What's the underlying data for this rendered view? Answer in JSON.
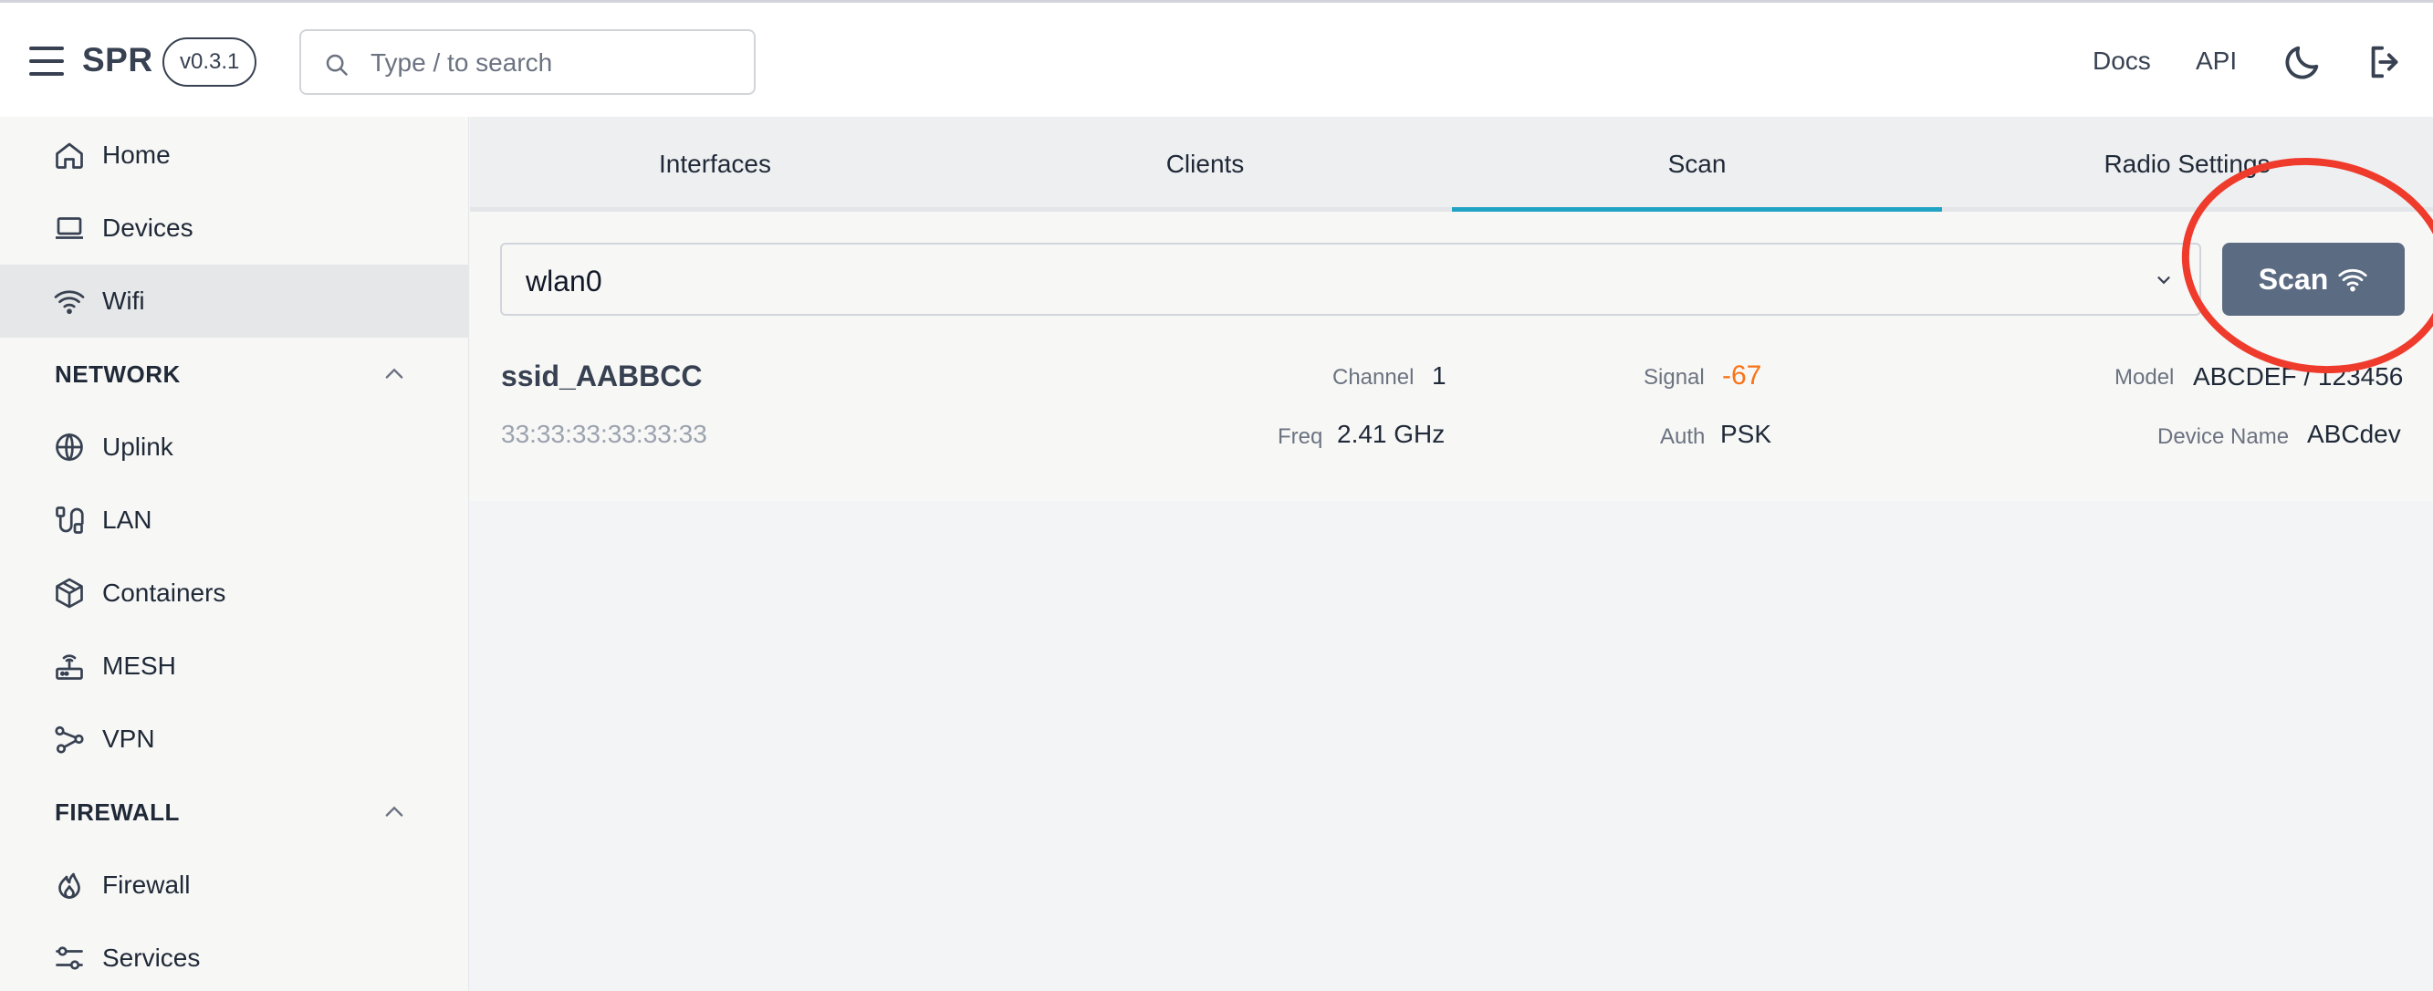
{
  "header": {
    "brand": "SPR",
    "version": "v0.3.1",
    "search_placeholder": "Type / to search",
    "links": {
      "docs": "Docs",
      "api": "API"
    }
  },
  "sidebar": {
    "items_top": [
      {
        "label": "Home",
        "icon": "home-icon"
      },
      {
        "label": "Devices",
        "icon": "laptop-icon"
      },
      {
        "label": "Wifi",
        "icon": "wifi-icon",
        "active": true
      }
    ],
    "network": {
      "heading": "NETWORK",
      "items": [
        {
          "label": "Uplink",
          "icon": "globe-icon"
        },
        {
          "label": "LAN",
          "icon": "cable-icon"
        },
        {
          "label": "Containers",
          "icon": "cube-icon"
        },
        {
          "label": "MESH",
          "icon": "router-icon"
        },
        {
          "label": "VPN",
          "icon": "share-network-icon"
        }
      ]
    },
    "firewall": {
      "heading": "FIREWALL",
      "items": [
        {
          "label": "Firewall",
          "icon": "flame-icon"
        },
        {
          "label": "Services",
          "icon": "sliders-icon"
        }
      ]
    }
  },
  "tabs": [
    {
      "label": "Interfaces"
    },
    {
      "label": "Clients"
    },
    {
      "label": "Scan",
      "active": true
    },
    {
      "label": "Radio Settings"
    }
  ],
  "scan": {
    "interface": "wlan0",
    "button_label": "Scan",
    "result": {
      "ssid": "ssid_AABBCC",
      "bssid": "33:33:33:33:33:33",
      "channel_label": "Channel",
      "channel": "1",
      "freq_label": "Freq",
      "freq": "2.41 GHz",
      "signal_label": "Signal",
      "signal": "-67",
      "auth_label": "Auth",
      "auth": "PSK",
      "model_label": "Model",
      "model": "ABCDEF / 123456",
      "device_name_label": "Device Name",
      "device_name": "ABCdev"
    }
  },
  "colors": {
    "accent_tab": "#21a3c4",
    "scan_button": "#5b6b82",
    "signal_value": "#f97316",
    "annotation_ring": "#ef3b2c"
  }
}
